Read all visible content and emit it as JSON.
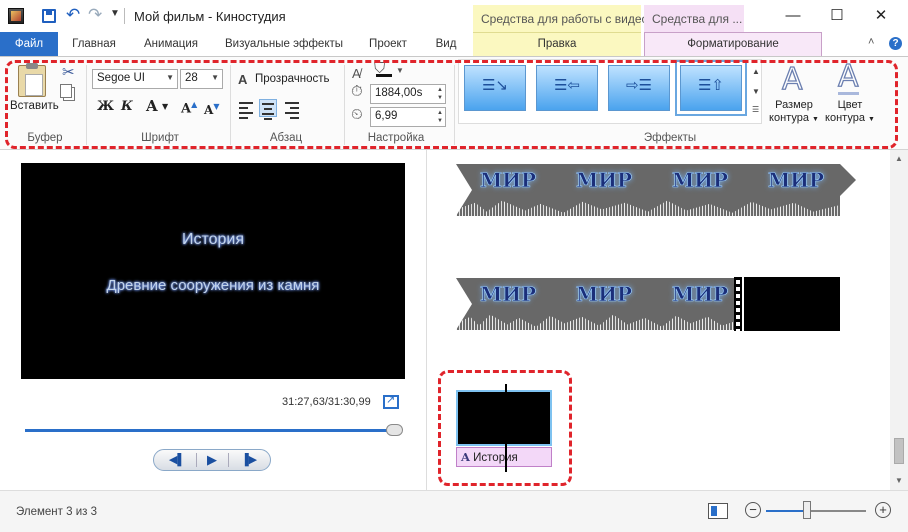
{
  "window": {
    "title": "Мой фильм - Киностудия",
    "ctx_video": "Средства для работы с видео",
    "ctx_format": "Средства для ...",
    "min": "—",
    "max": "☐",
    "close": "✕"
  },
  "tabs": {
    "file": "Файл",
    "home": "Главная",
    "animation": "Анимация",
    "visual_effects": "Визуальные эффекты",
    "project": "Проект",
    "view": "Вид",
    "edit": "Правка",
    "format": "Форматирование"
  },
  "ribbon": {
    "clipboard": {
      "paste": "Вставить",
      "group": "Буфер"
    },
    "font": {
      "family": "Segoe UI",
      "size": "28",
      "bold": "Ж",
      "italic": "К",
      "color": "A",
      "grow": "A",
      "shrink": "A",
      "group": "Шрифт"
    },
    "paragraph": {
      "transparency": "Прозрачность",
      "group": "Абзац"
    },
    "settings": {
      "start_time": "1884,00s",
      "duration": "6,99",
      "group": "Настройка"
    },
    "effects": {
      "group": "Эффекты"
    },
    "outline": {
      "size_line1": "Размер",
      "size_line2": "контура",
      "color_line1": "Цвет",
      "color_line2": "контура"
    }
  },
  "preview": {
    "caption_title": "История",
    "caption_subtitle": "Древние сооружения из камня",
    "timecode": "31:27,63/31:30,99",
    "seek_progress": 0.985
  },
  "storyboard": {
    "clip_word": "МИР",
    "text_item": "История"
  },
  "status": {
    "item_counter": "Элемент 3 из 3",
    "zoom_minus": "−",
    "zoom_plus": "+",
    "zoom_level": 0.4
  }
}
